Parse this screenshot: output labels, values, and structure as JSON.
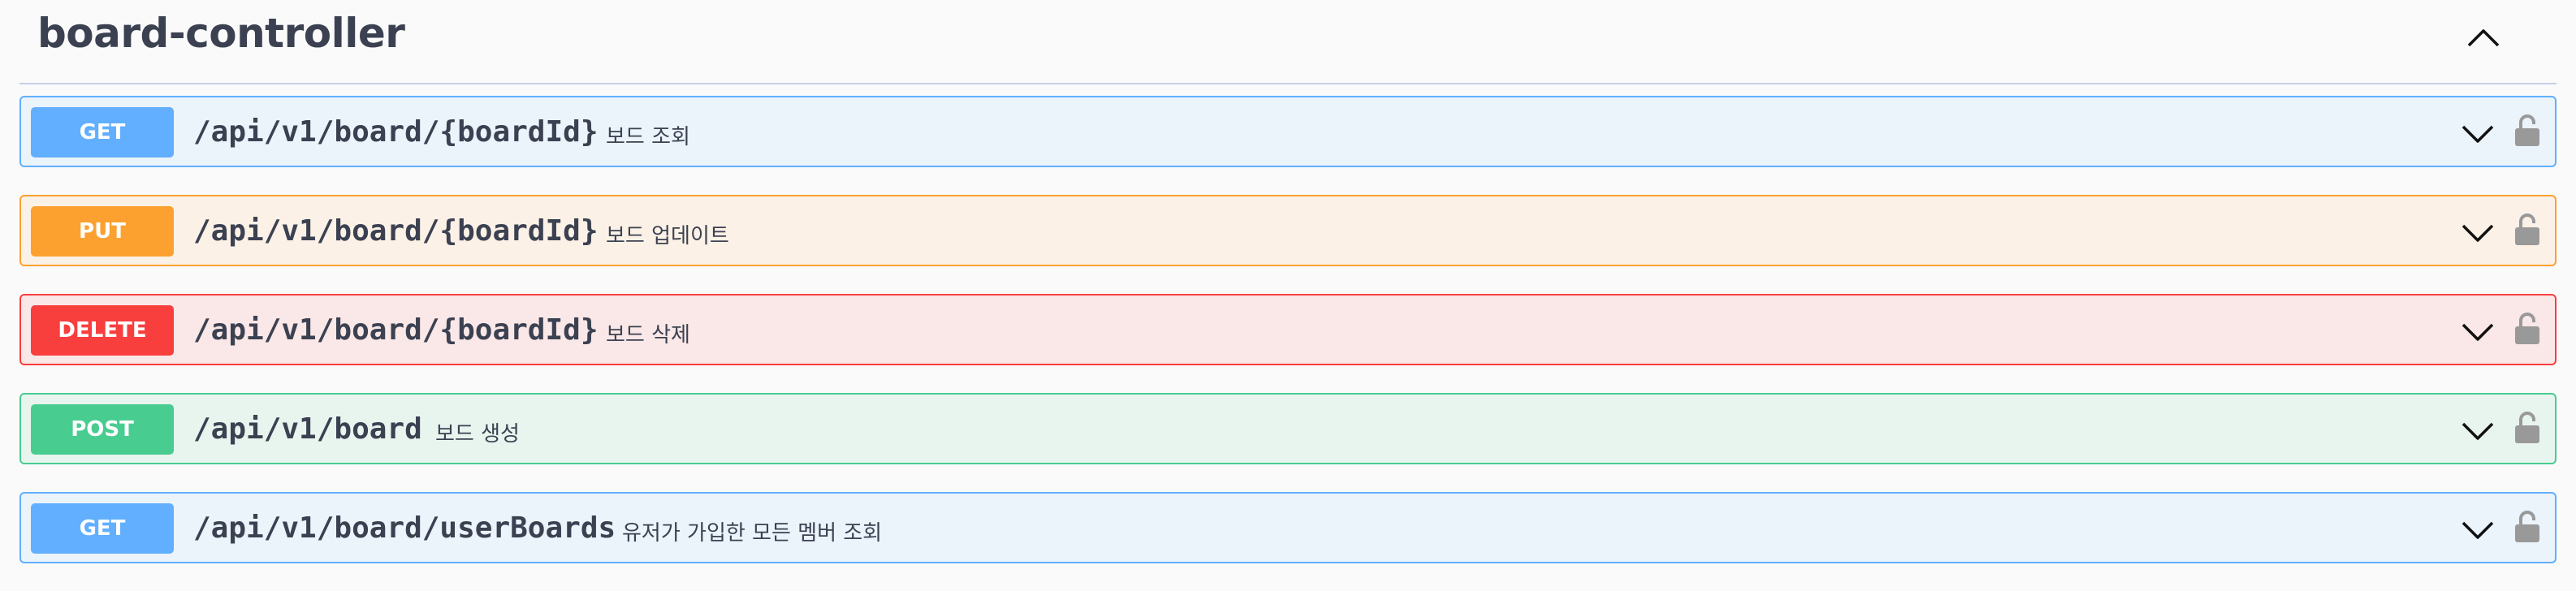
{
  "tag": {
    "title": "board-controller"
  },
  "colors": {
    "get": "#61affe",
    "put": "#fca130",
    "delete": "#f93e3e",
    "post": "#49cc90",
    "get_bg": "#ebf3fb",
    "put_bg": "#fbf1e6",
    "delete_bg": "#fae7e7",
    "post_bg": "#e8f5ef"
  },
  "operations": [
    {
      "method": "GET",
      "path": "/api/v1/board/{boardId}",
      "summary": "보드 조회",
      "icons": [
        "chevron-down-icon",
        "unlocked-icon"
      ]
    },
    {
      "method": "PUT",
      "path": "/api/v1/board/{boardId}",
      "summary": "보드 업데이트",
      "icons": [
        "chevron-down-icon",
        "unlocked-icon"
      ]
    },
    {
      "method": "DELETE",
      "path": "/api/v1/board/{boardId}",
      "summary": "보드 삭제",
      "icons": [
        "chevron-down-icon",
        "unlocked-icon"
      ]
    },
    {
      "method": "POST",
      "path": "/api/v1/board",
      "summary": "보드 생성",
      "icons": [
        "chevron-down-icon",
        "unlocked-icon"
      ]
    },
    {
      "method": "GET",
      "path": "/api/v1/board/userBoards",
      "summary": "유저가 가입한 모든 멤버 조회",
      "icons": [
        "chevron-down-icon",
        "unlocked-icon"
      ]
    }
  ]
}
